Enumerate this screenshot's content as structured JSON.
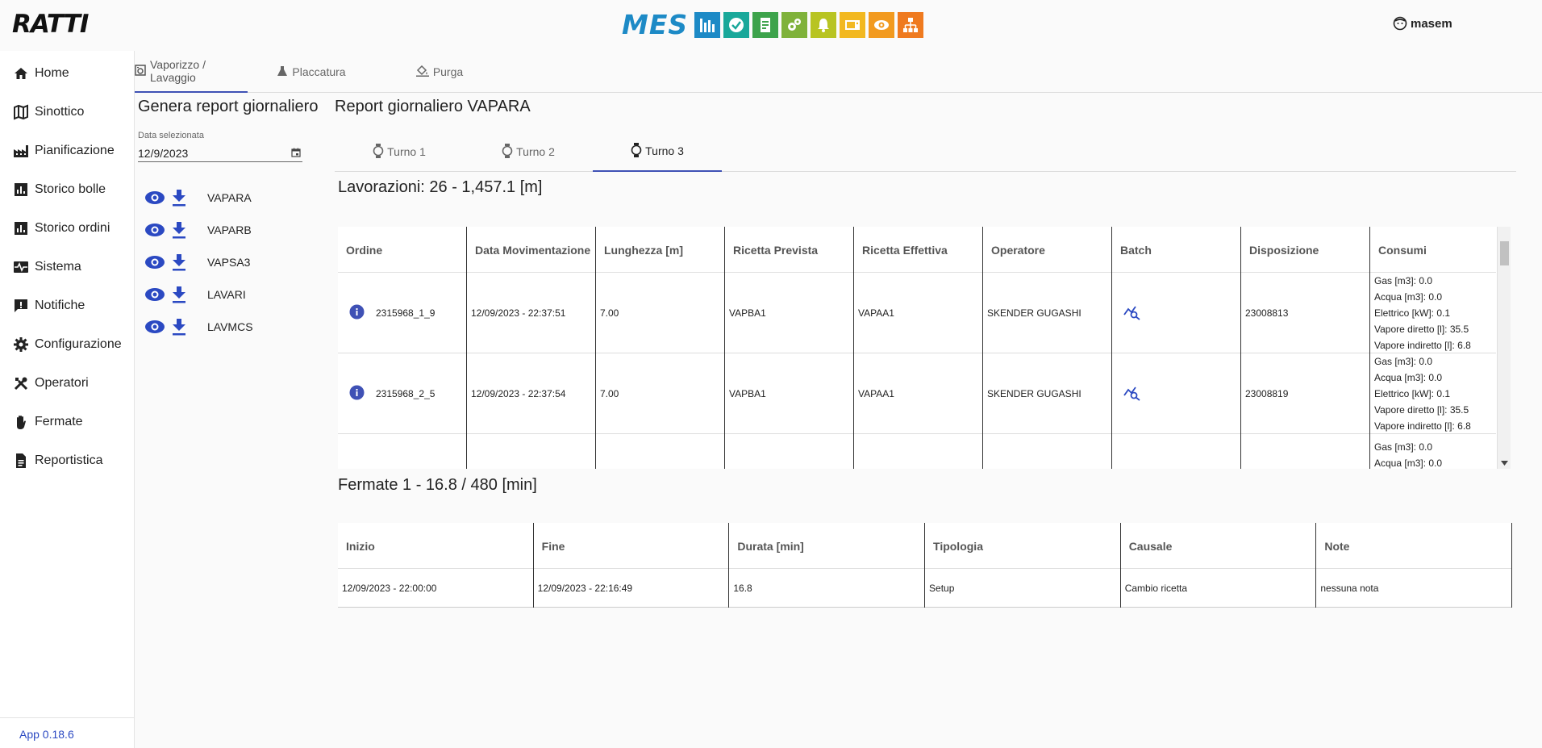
{
  "app": {
    "logo_text": "RATTI",
    "mes_word": "MES",
    "user_name": "masem",
    "version": "App 0.18.6"
  },
  "mes_tiles": [
    {
      "icon": "bar-chart-icon",
      "color": "#1d8ac6"
    },
    {
      "icon": "check-circle-icon",
      "color": "#19a89a"
    },
    {
      "icon": "document-icon",
      "color": "#3da34b"
    },
    {
      "icon": "gears-icon",
      "color": "#7fb23a"
    },
    {
      "icon": "bell-icon",
      "color": "#b8c422"
    },
    {
      "icon": "tv-icon",
      "color": "#f2b820"
    },
    {
      "icon": "eye-icon",
      "color": "#f29a1f"
    },
    {
      "icon": "hierarchy-icon",
      "color": "#ef7a1f"
    }
  ],
  "sidebar": {
    "items": [
      {
        "label": "Home",
        "icon": "home-icon"
      },
      {
        "label": "Sinottico",
        "icon": "map-icon"
      },
      {
        "label": "Pianificazione",
        "icon": "factory-icon"
      },
      {
        "label": "Storico bolle",
        "icon": "analytics-icon"
      },
      {
        "label": "Storico ordini",
        "icon": "analytics-icon"
      },
      {
        "label": "Sistema",
        "icon": "monitor-heart-icon"
      },
      {
        "label": "Notifiche",
        "icon": "feedback-icon"
      },
      {
        "label": "Configurazione",
        "icon": "gear-icon"
      },
      {
        "label": "Operatori",
        "icon": "tools-icon"
      },
      {
        "label": "Fermate",
        "icon": "hand-icon"
      },
      {
        "label": "Reportistica",
        "icon": "document-icon"
      }
    ]
  },
  "main_tabs": [
    {
      "label": "Vaporizzo / Lavaggio",
      "icon": "washing-machine-icon"
    },
    {
      "label": "Placcatura",
      "icon": "flask-icon"
    },
    {
      "label": "Purga",
      "icon": "paint-bucket-icon"
    }
  ],
  "left_panel": {
    "title": "Genera report giornaliero",
    "date_label": "Data selezionata",
    "date_value": "12/9/2023",
    "machines": [
      "VAPARA",
      "VAPARB",
      "VAPSA3",
      "LAVARI",
      "LAVMCS"
    ]
  },
  "report": {
    "title": "Report giornaliero VAPARA",
    "shifts": [
      "Turno 1",
      "Turno 2",
      "Turno 3"
    ],
    "active_shift": "Turno 3",
    "lavorazioni_title": "Lavorazioni: 26 - 1,457.1 [m]",
    "lavorazioni_columns": [
      "Ordine",
      "Data Movimentazione",
      "Lunghezza [m]",
      "Ricetta Prevista",
      "Ricetta Effettiva",
      "Operatore",
      "Batch",
      "Disposizione",
      "Consumi"
    ],
    "lavorazioni_rows": [
      {
        "ordine": "2315968_1_9",
        "data": "12/09/2023 - 22:37:51",
        "lunghezza": "7.00",
        "ricetta_prevista": "VAPBA1",
        "ricetta_effettiva": "VAPAA1",
        "operatore": "SKENDER GUGASHI",
        "disposizione": "23008813",
        "consumi": [
          "Gas [m3]: 0.0",
          "Acqua [m3]: 0.0",
          "Elettrico [kW]: 0.1",
          "Vapore diretto [l]: 35.5",
          "Vapore indiretto [l]: 6.8"
        ]
      },
      {
        "ordine": "2315968_2_5",
        "data": "12/09/2023 - 22:37:54",
        "lunghezza": "7.00",
        "ricetta_prevista": "VAPBA1",
        "ricetta_effettiva": "VAPAA1",
        "operatore": "SKENDER GUGASHI",
        "disposizione": "23008819",
        "consumi": [
          "Gas [m3]: 0.0",
          "Acqua [m3]: 0.0",
          "Elettrico [kW]: 0.1",
          "Vapore diretto [l]: 35.5",
          "Vapore indiretto [l]: 6.8"
        ]
      },
      {
        "ordine": "",
        "data": "",
        "lunghezza": "",
        "ricetta_prevista": "",
        "ricetta_effettiva": "",
        "operatore": "",
        "disposizione": "",
        "consumi": [
          "Gas [m3]: 0.0",
          "Acqua [m3]: 0.0"
        ]
      }
    ],
    "fermate_title": "Fermate 1 - 16.8 / 480 [min]",
    "fermate_columns": [
      "Inizio",
      "Fine",
      "Durata [min]",
      "Tipologia",
      "Causale",
      "Note"
    ],
    "fermate_rows": [
      [
        "12/09/2023 - 22:00:00",
        "12/09/2023 - 22:16:49",
        "16.8",
        "Setup",
        "Cambio ricetta",
        "nessuna nota"
      ]
    ]
  },
  "colors": {
    "accent": "#3f51b5",
    "icon_blue": "#2b49c2",
    "version_blue": "#2b49c2"
  }
}
